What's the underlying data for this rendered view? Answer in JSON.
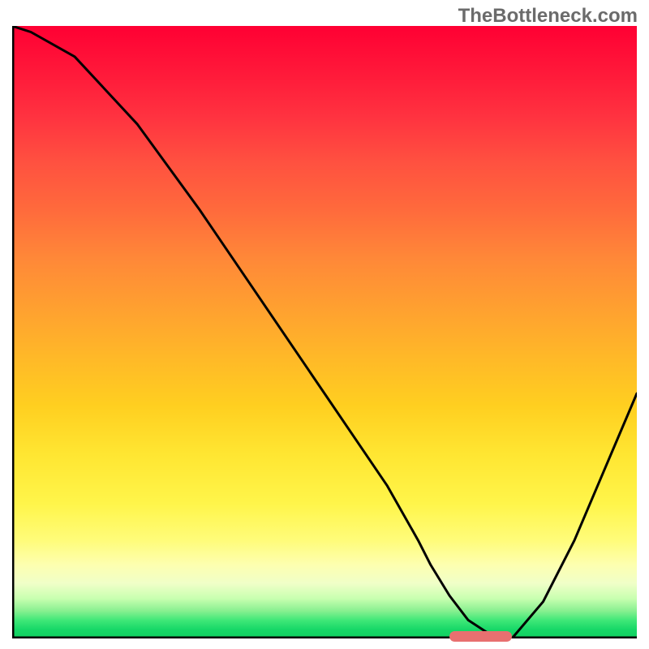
{
  "watermark": "TheBottleneck.com",
  "chart_data": {
    "type": "line",
    "title": "",
    "xlabel": "",
    "ylabel": "",
    "xlim": [
      0,
      100
    ],
    "ylim": [
      0,
      100
    ],
    "x": [
      0,
      3,
      10,
      20,
      30,
      40,
      50,
      60,
      65,
      67,
      70,
      73,
      76,
      80,
      85,
      90,
      95,
      100
    ],
    "values": [
      100,
      99,
      95,
      84,
      70,
      55,
      40,
      25,
      16,
      12,
      7,
      3,
      1,
      0,
      6,
      16,
      28,
      40
    ],
    "note": "y=0 is the bottom green band (minimum / optimal point). y=100 is top of the gradient.",
    "marker": {
      "x_start": 70,
      "x_end": 80,
      "y": 0
    },
    "colors": {
      "curve": "#000000",
      "marker": "#e87070",
      "axis": "#000000",
      "gradient_top": "#ff0033",
      "gradient_mid": "#ffe632",
      "gradient_bottom": "#10d060"
    }
  }
}
